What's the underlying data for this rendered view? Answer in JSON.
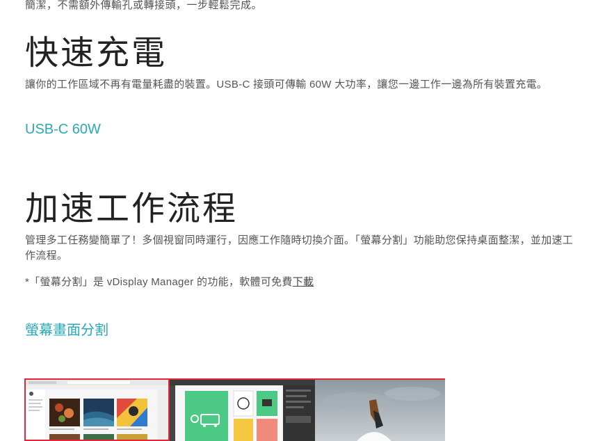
{
  "intro": {
    "tail_text": "簡潔，不需額外傳輸孔或轉接頭，一步輕鬆完成。"
  },
  "fast_charge": {
    "heading": "快速充電",
    "description": "讓你的工作區域不再有電量耗盡的裝置。USB-C 接頭可傳輸 60W 大功率，讓您一邊工作一邊為所有裝置充電。",
    "feature_label": "USB-C 60W"
  },
  "workflow": {
    "heading": "加速工作流程",
    "description": "管理多工任務變簡單了！多個視窗同時運行，因應工作隨時切換介面。「螢幕分割」功能助您保持桌面整潔，並加速工作流程。",
    "note_text": "*「螢幕分割」是 vDisplay Manager 的功能，軟體可免費",
    "note_link": "下載",
    "feature_label": "螢幕畫面分割"
  },
  "colors": {
    "accent": "#2aa9b5",
    "highlight_border": "#e0283a"
  }
}
